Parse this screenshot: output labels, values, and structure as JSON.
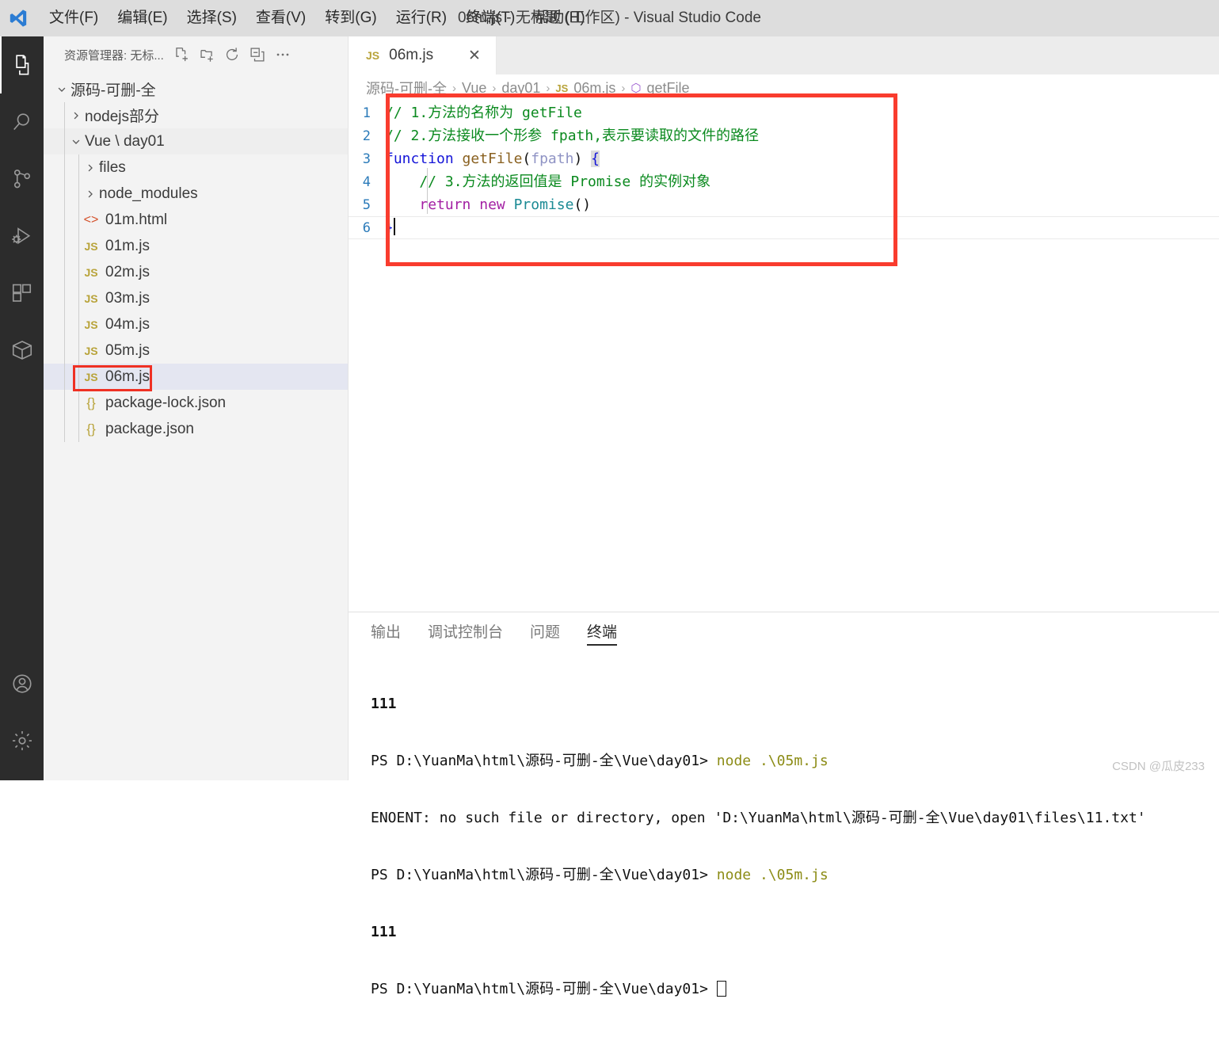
{
  "titlebar": {
    "window_title": "06m.js - 无标题 (工作区) - Visual Studio Code",
    "menus": [
      {
        "label": "文件(F)",
        "key": "F"
      },
      {
        "label": "编辑(E)",
        "key": "E"
      },
      {
        "label": "选择(S)",
        "key": "S"
      },
      {
        "label": "查看(V)",
        "key": "V"
      },
      {
        "label": "转到(G)",
        "key": "G"
      },
      {
        "label": "运行(R)",
        "key": "R"
      },
      {
        "label": "终端(T)",
        "key": "T"
      },
      {
        "label": "帮助(H)",
        "key": "H"
      }
    ]
  },
  "activitybar": {
    "icons": [
      {
        "name": "explorer-icon",
        "active": true
      },
      {
        "name": "search-icon",
        "active": false
      },
      {
        "name": "source-control-icon",
        "active": false
      },
      {
        "name": "run-and-debug-icon",
        "active": false
      },
      {
        "name": "extensions-icon",
        "active": false
      },
      {
        "name": "remote-explorer-icon",
        "active": false
      }
    ],
    "bottom_icons": [
      {
        "name": "accounts-icon"
      },
      {
        "name": "settings-gear-icon"
      }
    ]
  },
  "sidebar": {
    "title": "资源管理器: 无标...",
    "actions": [
      {
        "name": "new-file-icon",
        "title": "新建文件"
      },
      {
        "name": "new-folder-icon",
        "title": "新建文件夹"
      },
      {
        "name": "refresh-icon",
        "title": "刷新资源管理器"
      },
      {
        "name": "collapse-all-icon",
        "title": "折叠文件夹"
      },
      {
        "name": "more-actions-icon",
        "title": "视图和更多操作"
      }
    ],
    "tree": [
      {
        "label": "源码-可删-全",
        "type": "root",
        "depth": 0,
        "expanded": true,
        "icon": "chevron-down-icon"
      },
      {
        "label": "nodejs部分",
        "type": "folder",
        "depth": 1,
        "expanded": false,
        "icon": "chevron-right-icon"
      },
      {
        "label": "Vue \\ day01",
        "type": "folder",
        "depth": 1,
        "expanded": true,
        "icon": "chevron-down-icon",
        "highlighted": true
      },
      {
        "label": "files",
        "type": "folder",
        "depth": 2,
        "expanded": false,
        "icon": "chevron-right-icon"
      },
      {
        "label": "node_modules",
        "type": "folder",
        "depth": 2,
        "expanded": false,
        "icon": "chevron-right-icon"
      },
      {
        "label": "01m.html",
        "type": "file",
        "depth": 2,
        "ficon": "html",
        "ficon_text": "<>"
      },
      {
        "label": "01m.js",
        "type": "file",
        "depth": 2,
        "ficon": "js",
        "ficon_text": "JS"
      },
      {
        "label": "02m.js",
        "type": "file",
        "depth": 2,
        "ficon": "js",
        "ficon_text": "JS"
      },
      {
        "label": "03m.js",
        "type": "file",
        "depth": 2,
        "ficon": "js",
        "ficon_text": "JS"
      },
      {
        "label": "04m.js",
        "type": "file",
        "depth": 2,
        "ficon": "js",
        "ficon_text": "JS"
      },
      {
        "label": "05m.js",
        "type": "file",
        "depth": 2,
        "ficon": "js",
        "ficon_text": "JS"
      },
      {
        "label": "06m.js",
        "type": "file",
        "depth": 2,
        "ficon": "js",
        "ficon_text": "JS",
        "selected": true,
        "annotated": true
      },
      {
        "label": "package-lock.json",
        "type": "file",
        "depth": 2,
        "ficon": "json",
        "ficon_text": "{}"
      },
      {
        "label": "package.json",
        "type": "file",
        "depth": 2,
        "ficon": "json",
        "ficon_text": "{}"
      }
    ]
  },
  "editor": {
    "tab": {
      "icon_text": "JS",
      "label": "06m.js",
      "close_glyph": "✕"
    },
    "breadcrumb": [
      {
        "label": "源码-可删-全",
        "type": "folder"
      },
      {
        "label": "Vue",
        "type": "folder"
      },
      {
        "label": "day01",
        "type": "folder"
      },
      {
        "label": "06m.js",
        "type": "file",
        "icon_text": "JS"
      },
      {
        "label": "getFile",
        "type": "symbol",
        "icon_text": "⬡"
      }
    ],
    "breadcrumb_separator": "›",
    "lines": [
      {
        "n": "1",
        "tokens": [
          {
            "t": "// 1.",
            "c": "comment"
          },
          {
            "t": "方法的名称为 getFile",
            "c": "comment"
          }
        ]
      },
      {
        "n": "2",
        "tokens": [
          {
            "t": "// 2.",
            "c": "comment"
          },
          {
            "t": "方法接收一个形参 fpath,表示要读取的文件的路径",
            "c": "comment"
          }
        ]
      },
      {
        "n": "3",
        "tokens": [
          {
            "t": "function",
            "c": "kw"
          },
          {
            "t": " ",
            "c": "plain"
          },
          {
            "t": "getFile",
            "c": "fn"
          },
          {
            "t": "(",
            "c": "plain"
          },
          {
            "t": "fpath",
            "c": "param"
          },
          {
            "t": ")",
            "c": "plain"
          },
          {
            "t": " ",
            "c": "plain"
          },
          {
            "t": "{",
            "c": "brace-match"
          }
        ]
      },
      {
        "n": "4",
        "tokens": [
          {
            "t": "    // 3.",
            "c": "comment"
          },
          {
            "t": "方法的返回值是 Promise 的实例对象",
            "c": "comment"
          }
        ]
      },
      {
        "n": "5",
        "tokens": [
          {
            "t": "    ",
            "c": "plain"
          },
          {
            "t": "return",
            "c": "ctrl"
          },
          {
            "t": " ",
            "c": "plain"
          },
          {
            "t": "new",
            "c": "ctrl"
          },
          {
            "t": " ",
            "c": "plain"
          },
          {
            "t": "Promise",
            "c": "type"
          },
          {
            "t": "()",
            "c": "plain"
          }
        ]
      },
      {
        "n": "6",
        "tokens": [
          {
            "t": "}",
            "c": "brace"
          }
        ],
        "cursor": true,
        "current": true
      }
    ]
  },
  "panel": {
    "tabs": [
      {
        "label": "输出",
        "active": false
      },
      {
        "label": "调试控制台",
        "active": false
      },
      {
        "label": "问题",
        "active": false
      },
      {
        "label": "终端",
        "active": true
      }
    ],
    "terminal_lines": [
      {
        "segments": [
          {
            "t": "111",
            "c": "num"
          }
        ]
      },
      {
        "segments": [
          {
            "t": "PS D:\\YuanMa\\html\\源码-可删-全\\Vue\\day01> ",
            "c": "path"
          },
          {
            "t": "node .\\05m.js",
            "c": "cmd"
          }
        ]
      },
      {
        "segments": [
          {
            "t": "ENOENT: no such file or directory, open 'D:\\YuanMa\\html\\源码-可删-全\\Vue\\day01\\files\\11.txt'",
            "c": "err"
          }
        ]
      },
      {
        "segments": [
          {
            "t": "PS D:\\YuanMa\\html\\源码-可删-全\\Vue\\day01> ",
            "c": "path"
          },
          {
            "t": "node .\\05m.js",
            "c": "cmd"
          }
        ]
      },
      {
        "segments": [
          {
            "t": "111",
            "c": "num"
          }
        ]
      },
      {
        "segments": [
          {
            "t": "PS D:\\YuanMa\\html\\源码-可删-全\\Vue\\day01> ",
            "c": "path"
          },
          {
            "t": "",
            "c": "cursor"
          }
        ]
      }
    ]
  },
  "watermark": "CSDN @瓜皮233",
  "colors": {
    "titlebar_bg": "#dddddd",
    "activitybar_bg": "#2c2c2c",
    "sidebar_bg": "#f3f3f3",
    "editor_bg": "#ffffff",
    "selection_bg": "#e4e6f1",
    "annotation_red": "#f93c2e",
    "js_icon": "#b8a33a",
    "linenumber": "#2a7ab9"
  }
}
